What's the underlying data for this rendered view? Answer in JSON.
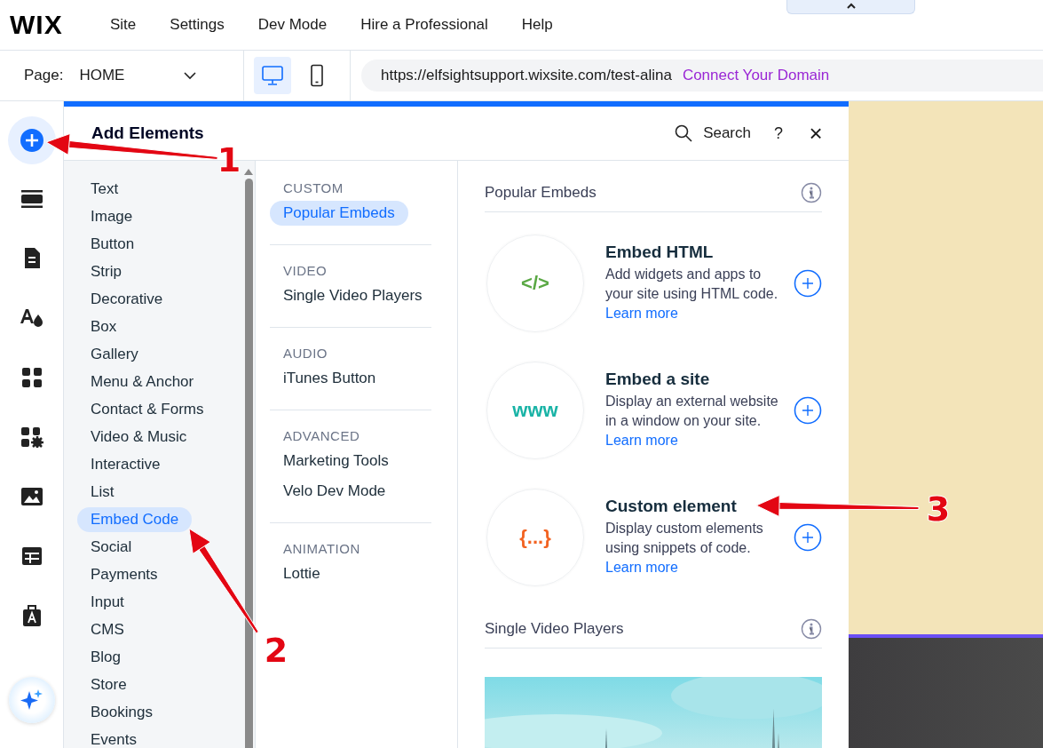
{
  "top_menu": {
    "logo": "WIX",
    "items": [
      "Site",
      "Settings",
      "Dev Mode",
      "Hire a Professional",
      "Help"
    ]
  },
  "toolbar": {
    "page_label": "Page:",
    "page_value": "HOME",
    "devices": [
      {
        "kind": "desktop",
        "selected": true
      },
      {
        "kind": "mobile",
        "selected": false
      }
    ],
    "url": "https://elfsightsupport.wixsite.com/test-alina",
    "connect_link": "Connect Your Domain"
  },
  "left_rail": [
    {
      "kind": "add",
      "selected": true
    },
    {
      "kind": "sections",
      "selected": false
    },
    {
      "kind": "pages",
      "selected": false
    },
    {
      "kind": "design",
      "selected": false
    },
    {
      "kind": "apps",
      "selected": false
    },
    {
      "kind": "business",
      "selected": false
    },
    {
      "kind": "media",
      "selected": false
    },
    {
      "kind": "cms",
      "selected": false
    },
    {
      "kind": "portfolio",
      "selected": false
    },
    {
      "kind": "ai",
      "selected": false
    }
  ],
  "panel": {
    "title": "Add Elements",
    "search": "Search",
    "help": "?",
    "close": "×",
    "categories": [
      {
        "label": "Text",
        "selected": false
      },
      {
        "label": "Image",
        "selected": false
      },
      {
        "label": "Button",
        "selected": false
      },
      {
        "label": "Strip",
        "selected": false
      },
      {
        "label": "Decorative",
        "selected": false
      },
      {
        "label": "Box",
        "selected": false
      },
      {
        "label": "Gallery",
        "selected": false
      },
      {
        "label": "Menu & Anchor",
        "selected": false
      },
      {
        "label": "Contact & Forms",
        "selected": false
      },
      {
        "label": "Video & Music",
        "selected": false
      },
      {
        "label": "Interactive",
        "selected": false
      },
      {
        "label": "List",
        "selected": false
      },
      {
        "label": "Embed Code",
        "selected": true
      },
      {
        "label": "Social",
        "selected": false
      },
      {
        "label": "Payments",
        "selected": false
      },
      {
        "label": "Input",
        "selected": false
      },
      {
        "label": "CMS",
        "selected": false
      },
      {
        "label": "Blog",
        "selected": false
      },
      {
        "label": "Store",
        "selected": false
      },
      {
        "label": "Bookings",
        "selected": false
      },
      {
        "label": "Events",
        "selected": false
      }
    ],
    "subcategories": [
      {
        "heading": "CUSTOM",
        "items": [
          {
            "label": "Popular Embeds",
            "selected": true
          }
        ]
      },
      {
        "heading": "VIDEO",
        "items": [
          {
            "label": "Single Video Players",
            "selected": false
          }
        ]
      },
      {
        "heading": "AUDIO",
        "items": [
          {
            "label": "iTunes Button",
            "selected": false
          }
        ]
      },
      {
        "heading": "ADVANCED",
        "items": [
          {
            "label": "Marketing Tools",
            "selected": false
          },
          {
            "label": "Velo Dev Mode",
            "selected": false
          }
        ]
      },
      {
        "heading": "ANIMATION",
        "items": [
          {
            "label": "Lottie",
            "selected": false
          }
        ]
      }
    ],
    "content_sections": [
      {
        "title": "Popular Embeds",
        "cards": [
          {
            "kind": "html",
            "icon_text": "</>",
            "title": "Embed HTML",
            "description": "Add widgets and apps to your site using HTML code.",
            "link": "Learn more"
          },
          {
            "kind": "site",
            "icon_text": "www",
            "title": "Embed a site",
            "description": "Display an external website in a window on your site.",
            "link": "Learn more"
          },
          {
            "kind": "custom",
            "icon_text": "{...}",
            "title": "Custom element",
            "description": "Display custom elements using snippets of code.",
            "link": "Learn more"
          }
        ]
      },
      {
        "title": "Single Video Players"
      }
    ]
  },
  "annotations": [
    {
      "label": "1"
    },
    {
      "label": "2"
    },
    {
      "label": "3"
    }
  ]
}
